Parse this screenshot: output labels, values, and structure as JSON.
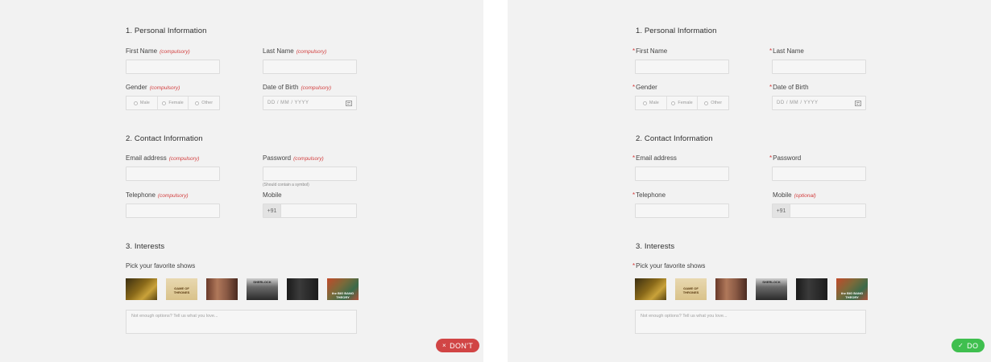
{
  "colors": {
    "required": "#d23b3b",
    "dont": "#d14545",
    "do": "#3fbf4f",
    "panel_bg": "#f2f2f2"
  },
  "left": {
    "personal_title": "1. Personal Information",
    "first_name_label": "First Name",
    "first_name_tag": "(compulsory)",
    "last_name_label": "Last Name",
    "last_name_tag": "(compulsory)",
    "gender_label": "Gender",
    "gender_tag": "(compulsory)",
    "gender_options": [
      "Male",
      "Female",
      "Other"
    ],
    "dob_label": "Date of Birth",
    "dob_tag": "(compulsory)",
    "dob_placeholder": "DD / MM / YYYY",
    "contact_title": "2. Contact Information",
    "email_label": "Email address",
    "email_tag": "(compulsory)",
    "password_label": "Password",
    "password_tag": "(compulsory)",
    "password_hint": "(Should contain a symbol)",
    "telephone_label": "Telephone",
    "telephone_tag": "(compulsory)",
    "mobile_label": "Mobile",
    "mobile_prefix": "+91",
    "interests_title": "3. Interests",
    "shows_label": "Pick your favorite shows",
    "textarea_placeholder": "Not enough options? Tell us what you love...",
    "badge_icon": "×",
    "badge_label": "DON'T"
  },
  "right": {
    "personal_title": "1. Personal Information",
    "required_mark": "*",
    "first_name_label": "First Name",
    "last_name_label": "Last Name",
    "gender_label": "Gender",
    "gender_options": [
      "Male",
      "Female",
      "Other"
    ],
    "dob_label": "Date of Birth",
    "dob_placeholder": "DD / MM / YYYY",
    "contact_title": "2. Contact Information",
    "email_label": "Email address",
    "password_label": "Password",
    "telephone_label": "Telephone",
    "mobile_label": "Mobile",
    "mobile_tag": "(optional)",
    "mobile_prefix": "+91",
    "interests_title": "3. Interests",
    "shows_label": "Pick your favorite shows",
    "textarea_placeholder": "Not enough options? Tell us what you love...",
    "badge_icon": "✓",
    "badge_label": "DO"
  },
  "shows": [
    {
      "icon": "breaking-bad-thumbnail",
      "title": ""
    },
    {
      "icon": "game-of-thrones-thumbnail",
      "title": "GAME OF THRONES"
    },
    {
      "icon": "friends-thumbnail",
      "title": ""
    },
    {
      "icon": "sherlock-thumbnail",
      "title": "SHERLOCK"
    },
    {
      "icon": "suits-thumbnail",
      "title": ""
    },
    {
      "icon": "big-bang-theory-thumbnail",
      "title": "the BIG BANG THEORY"
    }
  ]
}
